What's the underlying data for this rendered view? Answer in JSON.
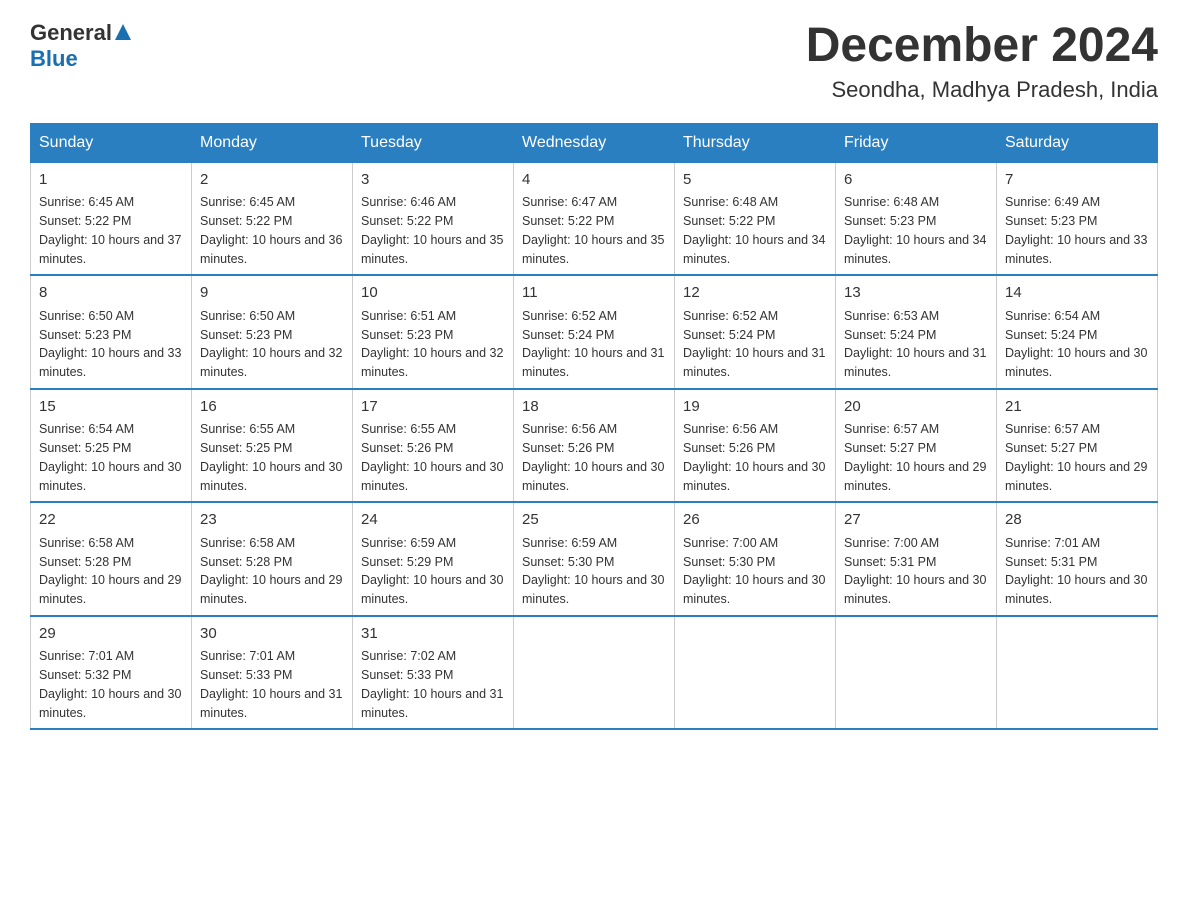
{
  "header": {
    "logo_general": "General",
    "logo_blue": "Blue",
    "title": "December 2024",
    "subtitle": "Seondha, Madhya Pradesh, India"
  },
  "days_of_week": [
    "Sunday",
    "Monday",
    "Tuesday",
    "Wednesday",
    "Thursday",
    "Friday",
    "Saturday"
  ],
  "weeks": [
    [
      {
        "day": "1",
        "sunrise": "6:45 AM",
        "sunset": "5:22 PM",
        "daylight": "10 hours and 37 minutes."
      },
      {
        "day": "2",
        "sunrise": "6:45 AM",
        "sunset": "5:22 PM",
        "daylight": "10 hours and 36 minutes."
      },
      {
        "day": "3",
        "sunrise": "6:46 AM",
        "sunset": "5:22 PM",
        "daylight": "10 hours and 35 minutes."
      },
      {
        "day": "4",
        "sunrise": "6:47 AM",
        "sunset": "5:22 PM",
        "daylight": "10 hours and 35 minutes."
      },
      {
        "day": "5",
        "sunrise": "6:48 AM",
        "sunset": "5:22 PM",
        "daylight": "10 hours and 34 minutes."
      },
      {
        "day": "6",
        "sunrise": "6:48 AM",
        "sunset": "5:23 PM",
        "daylight": "10 hours and 34 minutes."
      },
      {
        "day": "7",
        "sunrise": "6:49 AM",
        "sunset": "5:23 PM",
        "daylight": "10 hours and 33 minutes."
      }
    ],
    [
      {
        "day": "8",
        "sunrise": "6:50 AM",
        "sunset": "5:23 PM",
        "daylight": "10 hours and 33 minutes."
      },
      {
        "day": "9",
        "sunrise": "6:50 AM",
        "sunset": "5:23 PM",
        "daylight": "10 hours and 32 minutes."
      },
      {
        "day": "10",
        "sunrise": "6:51 AM",
        "sunset": "5:23 PM",
        "daylight": "10 hours and 32 minutes."
      },
      {
        "day": "11",
        "sunrise": "6:52 AM",
        "sunset": "5:24 PM",
        "daylight": "10 hours and 31 minutes."
      },
      {
        "day": "12",
        "sunrise": "6:52 AM",
        "sunset": "5:24 PM",
        "daylight": "10 hours and 31 minutes."
      },
      {
        "day": "13",
        "sunrise": "6:53 AM",
        "sunset": "5:24 PM",
        "daylight": "10 hours and 31 minutes."
      },
      {
        "day": "14",
        "sunrise": "6:54 AM",
        "sunset": "5:24 PM",
        "daylight": "10 hours and 30 minutes."
      }
    ],
    [
      {
        "day": "15",
        "sunrise": "6:54 AM",
        "sunset": "5:25 PM",
        "daylight": "10 hours and 30 minutes."
      },
      {
        "day": "16",
        "sunrise": "6:55 AM",
        "sunset": "5:25 PM",
        "daylight": "10 hours and 30 minutes."
      },
      {
        "day": "17",
        "sunrise": "6:55 AM",
        "sunset": "5:26 PM",
        "daylight": "10 hours and 30 minutes."
      },
      {
        "day": "18",
        "sunrise": "6:56 AM",
        "sunset": "5:26 PM",
        "daylight": "10 hours and 30 minutes."
      },
      {
        "day": "19",
        "sunrise": "6:56 AM",
        "sunset": "5:26 PM",
        "daylight": "10 hours and 30 minutes."
      },
      {
        "day": "20",
        "sunrise": "6:57 AM",
        "sunset": "5:27 PM",
        "daylight": "10 hours and 29 minutes."
      },
      {
        "day": "21",
        "sunrise": "6:57 AM",
        "sunset": "5:27 PM",
        "daylight": "10 hours and 29 minutes."
      }
    ],
    [
      {
        "day": "22",
        "sunrise": "6:58 AM",
        "sunset": "5:28 PM",
        "daylight": "10 hours and 29 minutes."
      },
      {
        "day": "23",
        "sunrise": "6:58 AM",
        "sunset": "5:28 PM",
        "daylight": "10 hours and 29 minutes."
      },
      {
        "day": "24",
        "sunrise": "6:59 AM",
        "sunset": "5:29 PM",
        "daylight": "10 hours and 30 minutes."
      },
      {
        "day": "25",
        "sunrise": "6:59 AM",
        "sunset": "5:30 PM",
        "daylight": "10 hours and 30 minutes."
      },
      {
        "day": "26",
        "sunrise": "7:00 AM",
        "sunset": "5:30 PM",
        "daylight": "10 hours and 30 minutes."
      },
      {
        "day": "27",
        "sunrise": "7:00 AM",
        "sunset": "5:31 PM",
        "daylight": "10 hours and 30 minutes."
      },
      {
        "day": "28",
        "sunrise": "7:01 AM",
        "sunset": "5:31 PM",
        "daylight": "10 hours and 30 minutes."
      }
    ],
    [
      {
        "day": "29",
        "sunrise": "7:01 AM",
        "sunset": "5:32 PM",
        "daylight": "10 hours and 30 minutes."
      },
      {
        "day": "30",
        "sunrise": "7:01 AM",
        "sunset": "5:33 PM",
        "daylight": "10 hours and 31 minutes."
      },
      {
        "day": "31",
        "sunrise": "7:02 AM",
        "sunset": "5:33 PM",
        "daylight": "10 hours and 31 minutes."
      },
      null,
      null,
      null,
      null
    ]
  ],
  "labels": {
    "sunrise_prefix": "Sunrise: ",
    "sunset_prefix": "Sunset: ",
    "daylight_prefix": "Daylight: "
  }
}
